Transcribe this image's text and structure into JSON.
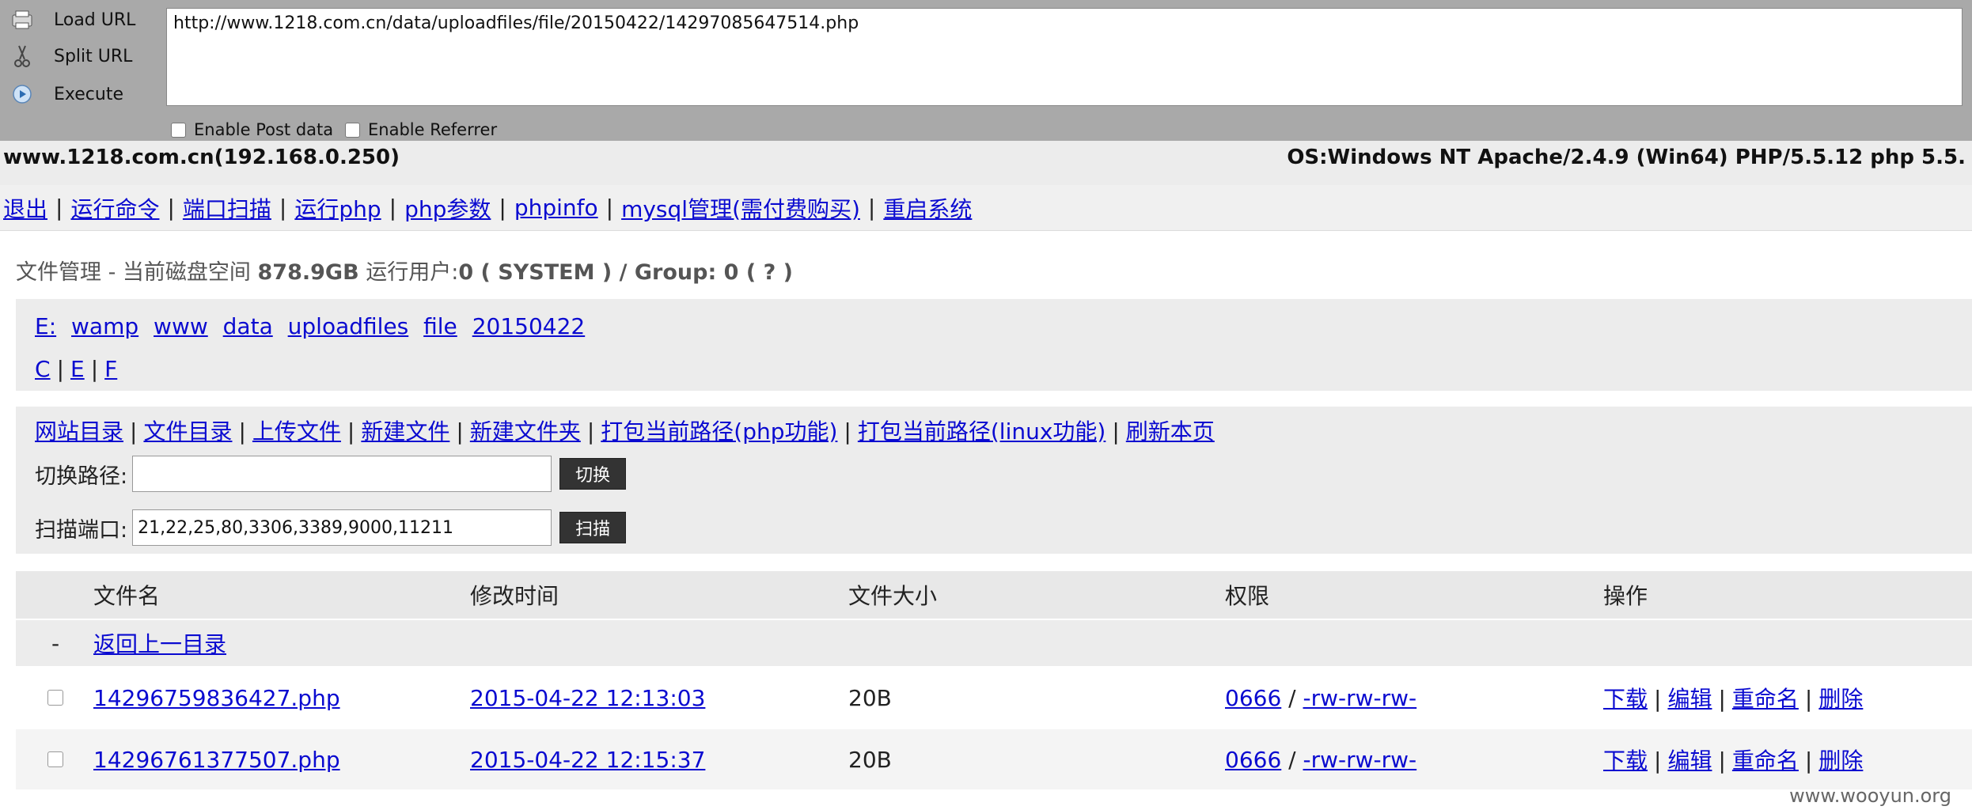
{
  "hackbar": {
    "load_url": "Load URL",
    "split_url": "Split URL",
    "execute": "Execute",
    "url_value": "http://www.1218.com.cn/data/uploadfiles/file/20150422/14297085647514.php",
    "enable_post": "Enable Post data",
    "enable_referrer": "Enable Referrer"
  },
  "host": {
    "left": "www.1218.com.cn(192.168.0.250)",
    "right": "OS:Windows NT Apache/2.4.9 (Win64) PHP/5.5.12 php 5.5."
  },
  "nav": [
    "退出",
    "运行命令",
    "端口扫描",
    "运行php",
    "php参数",
    "phpinfo",
    "mysql管理(需付费购买)",
    "重启系统"
  ],
  "disk": {
    "prefix": "文件管理 - 当前磁盘空间",
    "space": "878.9GB",
    "user_label": "运行用户:",
    "user_value": "0 ( SYSTEM ) / Group: 0 ( ? )"
  },
  "path": [
    "E:",
    "wamp",
    "www",
    "data",
    "uploadfiles",
    "file",
    "20150422"
  ],
  "drives": [
    "C",
    "E",
    "F"
  ],
  "tools": [
    "网站目录",
    "文件目录",
    "上传文件",
    "新建文件",
    "新建文件夹",
    "打包当前路径(php功能)",
    "打包当前路径(linux功能)",
    "刷新本页"
  ],
  "switch_path": {
    "label": "切换路径:",
    "value": "",
    "button": "切换"
  },
  "scan_port": {
    "label": "扫描端口:",
    "value": "21,22,25,80,3306,3389,9000,11211",
    "button": "扫描"
  },
  "table": {
    "headers": [
      "文件名",
      "修改时间",
      "文件大小",
      "权限",
      "操作"
    ],
    "up_marker": "-",
    "up_label": "返回上一目录",
    "rows": [
      {
        "name": "14296759836427.php",
        "time": "2015-04-22 12:13:03",
        "size": "20B",
        "perm_num": "0666",
        "perm_str": "-rw-rw-rw-"
      },
      {
        "name": "14296761377507.php",
        "time": "2015-04-22 12:15:37",
        "size": "20B",
        "perm_num": "0666",
        "perm_str": "-rw-rw-rw-"
      }
    ],
    "ops": [
      "下载",
      "编辑",
      "重命名",
      "删除"
    ]
  },
  "watermark": "www.wooyun.org"
}
